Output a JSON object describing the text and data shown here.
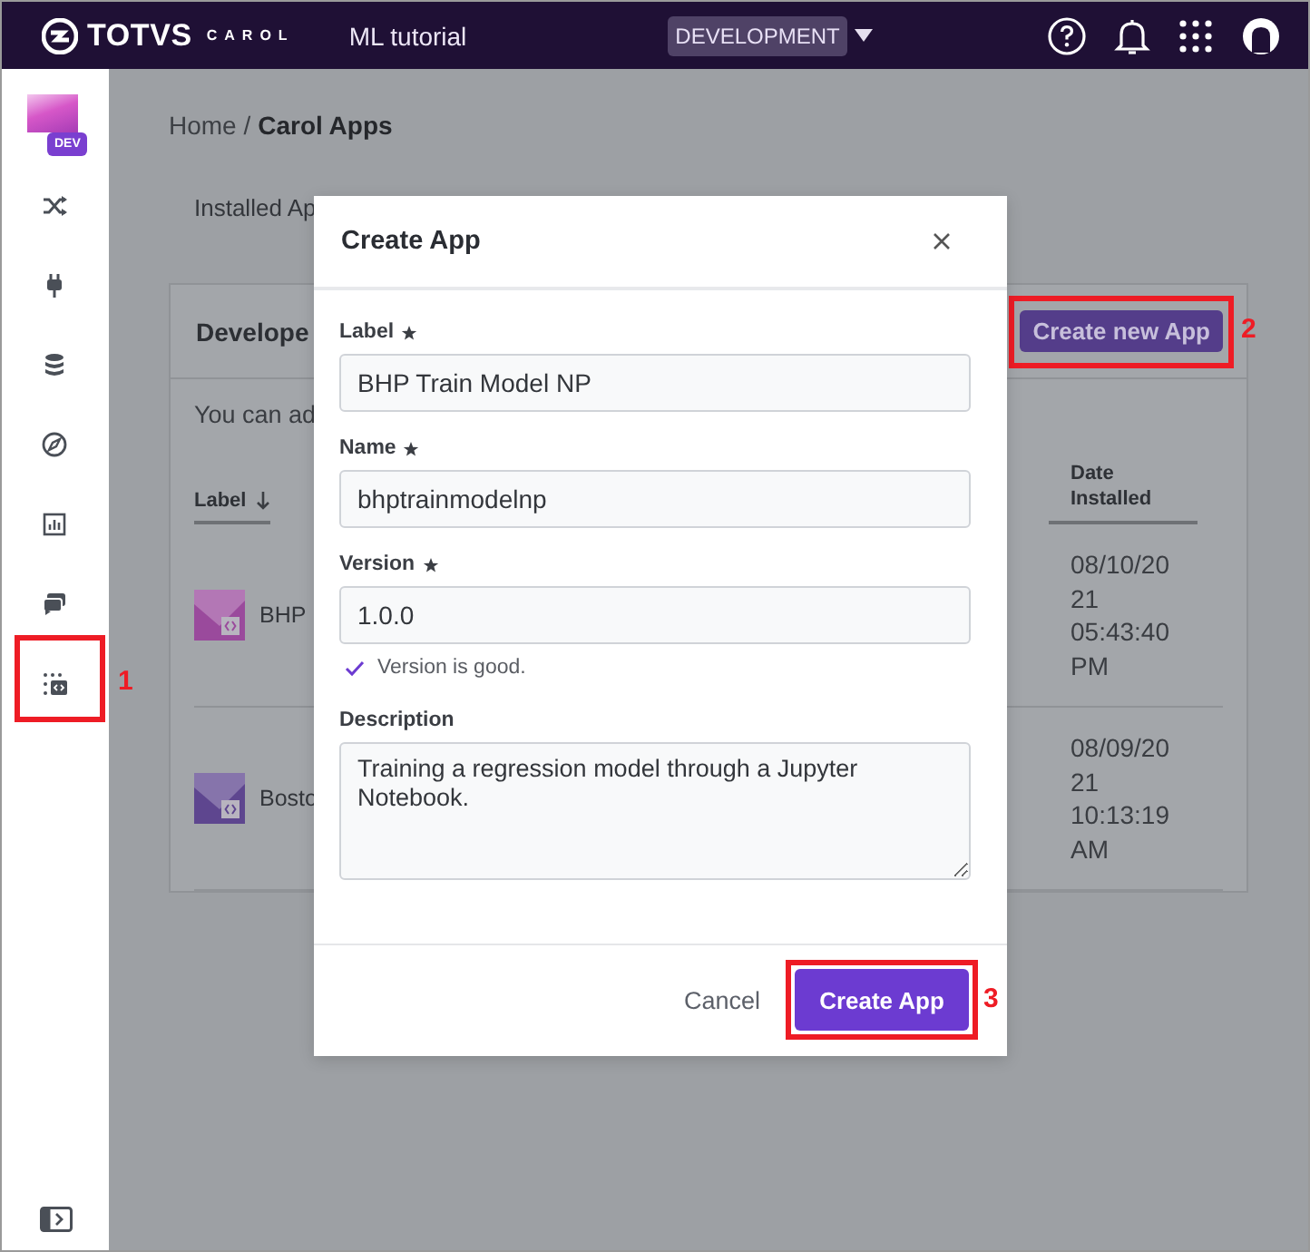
{
  "top_bar": {
    "logo_text": "TOTVS",
    "logo_subtext": "CAROL",
    "project": "ML tutorial",
    "environment": "DEVELOPMENT"
  },
  "sidebar": {
    "badge": "DEV",
    "items": [
      {
        "kind": "shuffle",
        "highlighted": false
      },
      {
        "kind": "plug",
        "highlighted": false
      },
      {
        "kind": "database",
        "highlighted": false
      },
      {
        "kind": "compass",
        "highlighted": false
      },
      {
        "kind": "chart",
        "highlighted": false
      },
      {
        "kind": "chat",
        "highlighted": false
      },
      {
        "kind": "apps",
        "highlighted": true,
        "callout": "1"
      }
    ]
  },
  "breadcrumb": {
    "parent": "Home /",
    "current": "Carol Apps"
  },
  "tabs": [
    {
      "label": "Installed Ap"
    }
  ],
  "card": {
    "title": "Develope",
    "create_button": {
      "label": "Create new App",
      "highlighted": true,
      "callout": "2"
    },
    "note": "You can ad",
    "columns": [
      {
        "label": "Label",
        "sorted": true
      },
      {
        "label": "Date Installed",
        "sorted": false
      }
    ],
    "rows": [
      {
        "label": "BHP",
        "date": "08/10/2021 05:43:40 PM",
        "color": "#9a4a9c"
      },
      {
        "label": "Bosto",
        "date": "08/09/2021 10:13:19 AM",
        "color": "#5e468f"
      }
    ]
  },
  "modal": {
    "title": "Create App",
    "fields": [
      {
        "kind": "input",
        "label": "Label",
        "required": true,
        "value": "BHP Train Model NP"
      },
      {
        "kind": "input",
        "label": "Name",
        "required": true,
        "value": "bhptrainmodelnp"
      },
      {
        "kind": "input",
        "label": "Version",
        "required": true,
        "value": "1.0.0",
        "hint": "Version is good."
      },
      {
        "kind": "textarea",
        "label": "Description",
        "required": false,
        "value": "Training a regression model through a Jupyter Notebook."
      }
    ],
    "cancel": "Cancel",
    "submit": {
      "label": "Create App",
      "highlighted": true,
      "callout": "3"
    }
  }
}
